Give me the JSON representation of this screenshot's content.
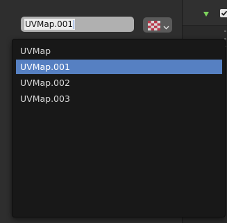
{
  "name_field": {
    "value": "UVMap.001"
  },
  "icon_dropdown": {
    "icon": "checker-texture-icon",
    "chevron": "chevron-down-icon"
  },
  "menu": {
    "items": [
      {
        "label": "UVMap"
      },
      {
        "label": "UVMap.001",
        "selected": true
      },
      {
        "label": "UVMap.002"
      },
      {
        "label": "UVMap.003"
      }
    ]
  },
  "right_header": {
    "expand_icon": "triangle-down-icon",
    "checkbox_checked": true
  },
  "colors": {
    "selected_item": "#5680c2",
    "menu_background": "#181818",
    "triangle": "#7dd35c"
  }
}
